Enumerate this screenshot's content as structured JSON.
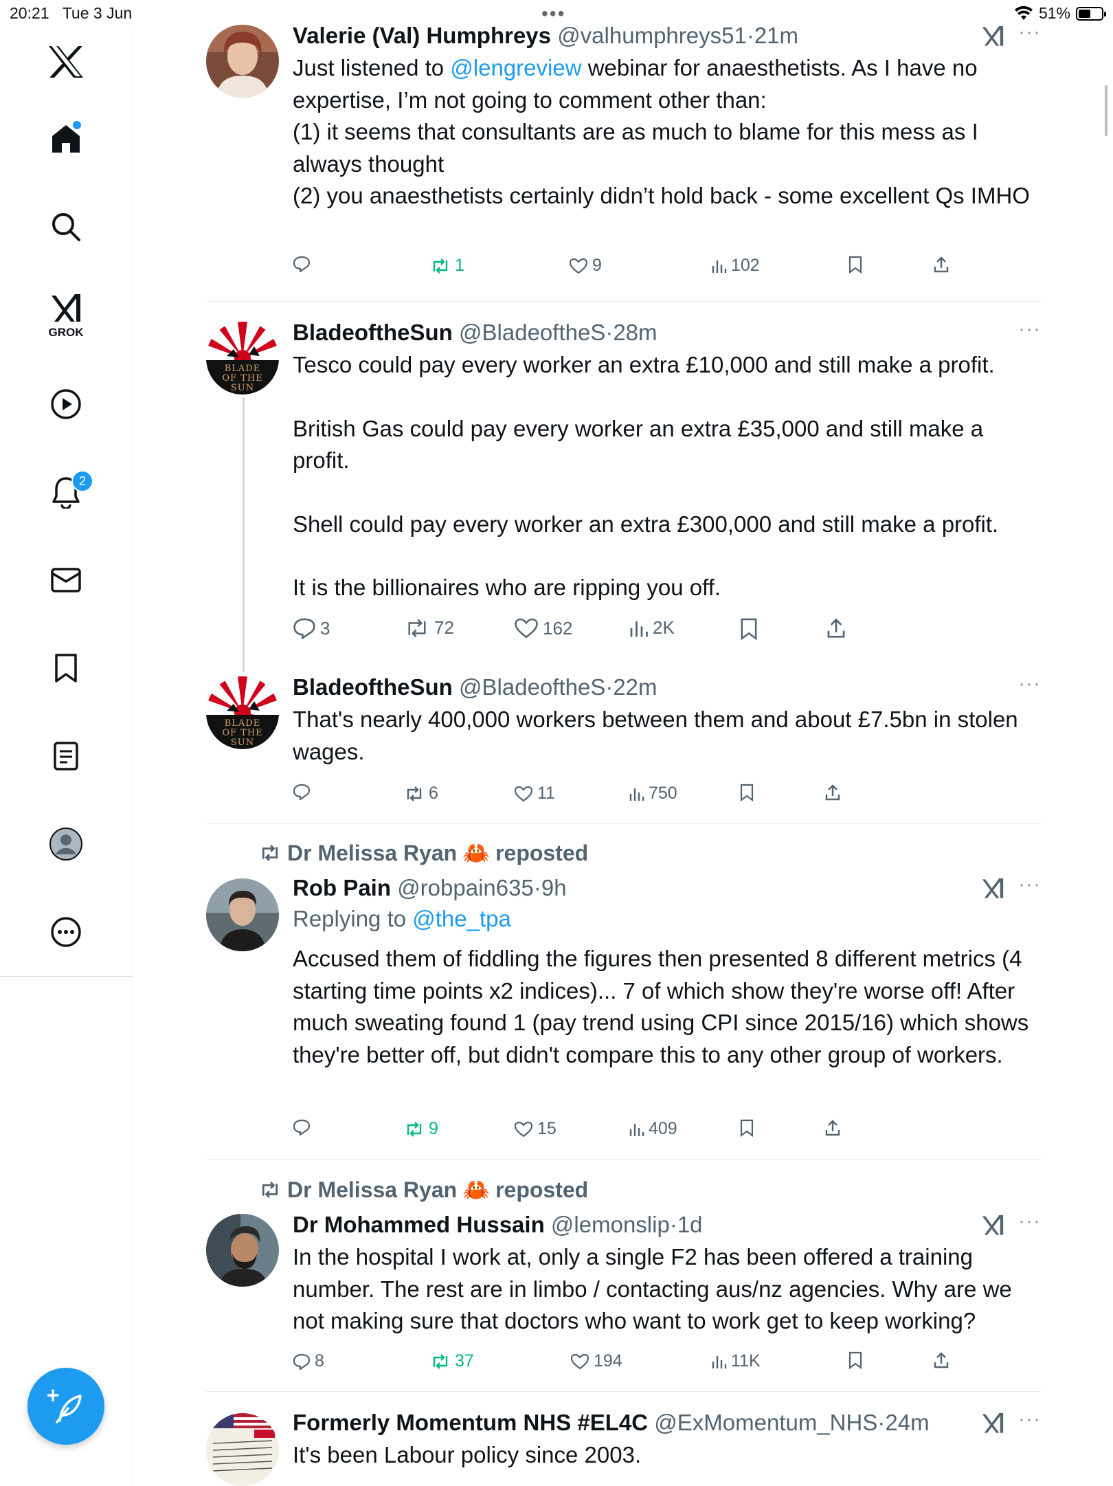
{
  "status_bar": {
    "time": "20:21",
    "date": "Tue 3 Jun",
    "battery": "51%"
  },
  "sidebar": {
    "items": [
      {
        "name": "x-logo",
        "label": "X"
      },
      {
        "name": "home",
        "label": "Home"
      },
      {
        "name": "explore",
        "label": "Search"
      },
      {
        "name": "grok",
        "label": "GROK"
      },
      {
        "name": "video",
        "label": "Video"
      },
      {
        "name": "notifications",
        "label": "Notifications",
        "badge": "2"
      },
      {
        "name": "messages",
        "label": "Messages"
      },
      {
        "name": "bookmarks",
        "label": "Bookmarks"
      },
      {
        "name": "lists",
        "label": "Lists"
      },
      {
        "name": "profile",
        "label": "Profile"
      },
      {
        "name": "more",
        "label": "More"
      }
    ],
    "compose_label": "Post"
  },
  "tweets": [
    {
      "name": "Valerie (Val) Humphreys",
      "handle": "@valhumphreys51",
      "time": "21m",
      "text_parts": [
        "Just listened to ",
        "@lengreview",
        " webinar for anaesthetists. As I have no expertise, I’m not going to comment other than:",
        "(1) it seems that consultants are as much to blame for this mess as I always thought",
        "(2) you anaesthetists certainly didn’t hold back - some excellent Qs IMHO"
      ],
      "replies": "",
      "reposts": "1",
      "likes": "9",
      "views": "102"
    },
    {
      "name": "BladeoftheSun",
      "handle": "@BladeoftheS",
      "time": "28m",
      "paragraphs": [
        "Tesco could pay every worker an extra £10,000 and still make a profit.",
        "British Gas could pay every worker an extra £35,000 and still make a profit.",
        "Shell could pay every worker an extra £300,000 and still make a profit.",
        "It is the billionaires who are ripping you off."
      ],
      "avatar_text": "BLADE OF THE SUN",
      "replies": "3",
      "reposts": "72",
      "likes": "162",
      "views": "2K"
    },
    {
      "name": "BladeoftheSun",
      "handle": "@BladeoftheS",
      "time": "22m",
      "text": "That's nearly 400,000 workers between them and about £7.5bn in stolen wages.",
      "replies": "",
      "reposts": "6",
      "likes": "11",
      "views": "750"
    },
    {
      "reposted_by": "Dr Melissa Ryan",
      "reposted_emoji": "🦀",
      "reposted_label": "reposted",
      "name": "Rob Pain",
      "handle": "@robpain635",
      "time": "9h",
      "replying_label": "Replying to ",
      "replying_to": "@the_tpa",
      "text": "Accused them of fiddling the figures then presented 8 different metrics (4 starting time points x2 indices)... 7 of which show they're worse off! After much sweating  found 1 (pay trend using CPI since 2015/16) which shows they're better off, but didn't compare this to any other group of workers.",
      "replies": "",
      "reposts": "9",
      "likes": "15",
      "views": "409"
    },
    {
      "reposted_by": "Dr Melissa Ryan",
      "reposted_emoji": "🦀",
      "reposted_label": "reposted",
      "name": "Dr Mohammed Hussain",
      "handle": "@lemonslip",
      "time": "1d",
      "text": "In the hospital I work at, only a single F2 has been offered a training number. The rest are in limbo / contacting aus/nz agencies. Why are we not making sure that doctors who want to work get to keep working?",
      "replies": "8",
      "reposts": "37",
      "likes": "194",
      "views": "11K"
    },
    {
      "name": "Formerly Momentum NHS #EL4C",
      "handle": "@ExMomentum_NHS",
      "time": "24m",
      "text": "It's been Labour policy since 2003."
    }
  ],
  "separator": "·",
  "more_glyph": "···"
}
